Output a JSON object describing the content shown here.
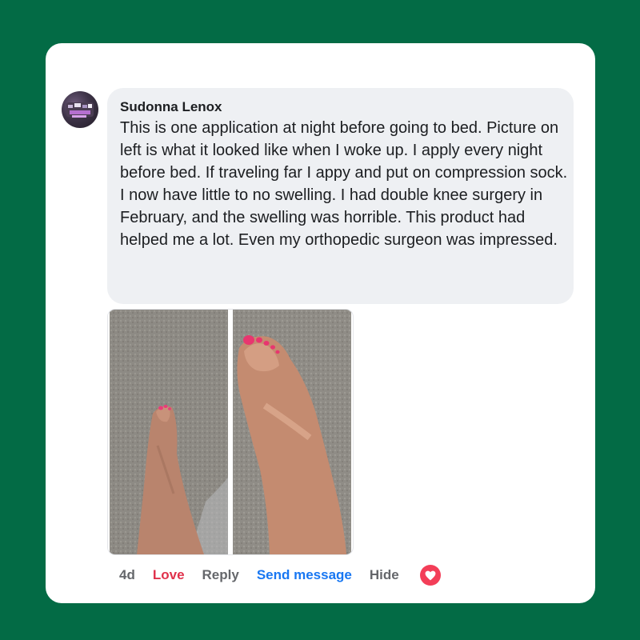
{
  "comment": {
    "author": "Sudonna Lenox",
    "text": "This is one application at night before going to bed. Picture on left is what it looked like when I woke up. I apply every night before bed. If traveling far I appy and put on compression sock. I now have little to no swelling. I had double knee surgery in February, and the swelling was horrible. This product had helped me a lot. Even my orthopedic surgeon was impressed.",
    "avatar_icon": "user-avatar-photo",
    "photos": [
      {
        "label": "foot-after-photo",
        "icon": "photo-foot"
      },
      {
        "label": "foot-before-photo",
        "icon": "photo-foot-swollen"
      }
    ]
  },
  "actions": {
    "time": "4d",
    "love": "Love",
    "reply": "Reply",
    "send_message": "Send message",
    "hide": "Hide",
    "reaction_icon": "heart-reaction-icon"
  },
  "colors": {
    "background": "#036b45",
    "bubble": "#eef0f3",
    "love": "#e0314b",
    "link": "#1877f2",
    "heart": "#f33e58"
  }
}
